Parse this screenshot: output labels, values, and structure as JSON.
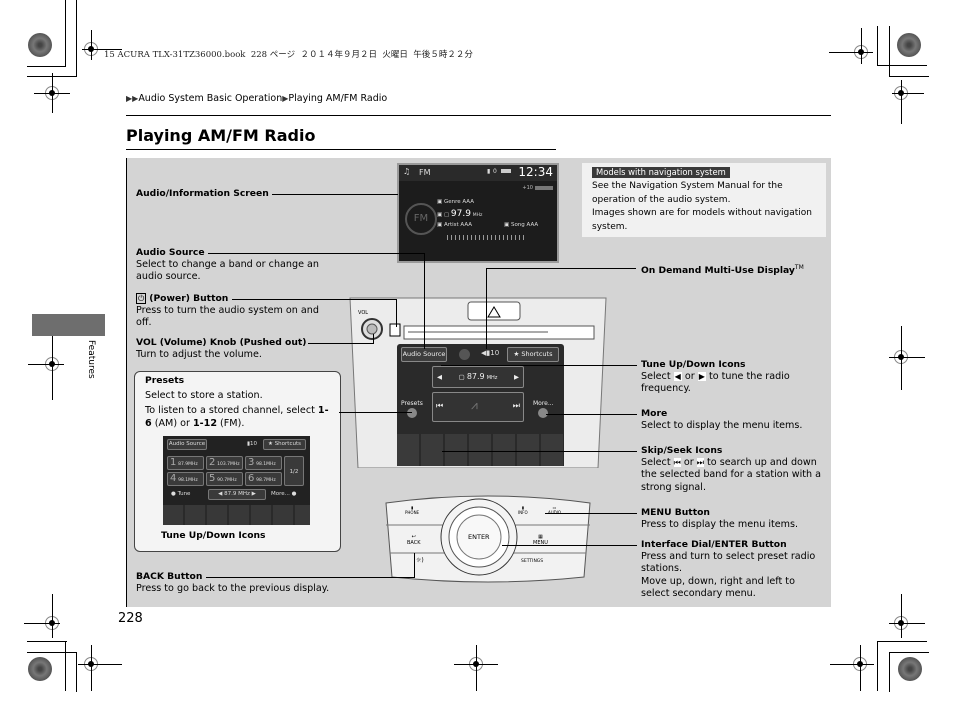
{
  "header_note": "15 ACURA TLX-31TZ36000.book  228 ページ  ２０１４年９月２日  火曜日  午後５時２２分",
  "breadcrumb": {
    "prefix": "▶▶",
    "section": "Audio System Basic Operation",
    "sep": "▶",
    "current": "Playing AM/FM Radio"
  },
  "page_title": "Playing AM/FM Radio",
  "side_tab_label": "Features",
  "page_number": "228",
  "nav_note": {
    "tag": "Models with navigation system",
    "line1": "See the Navigation System Manual for the operation of the audio system.",
    "line2": "Images shown are for models without navigation system."
  },
  "callouts_left": {
    "audio_info_screen": {
      "title": "Audio/Information Screen"
    },
    "audio_source": {
      "title": "Audio Source",
      "desc": "Select to change a band or change an audio source."
    },
    "power_button": {
      "icon": "⏻",
      "title": "(Power) Button",
      "desc": "Press to turn the audio system on and off."
    },
    "vol_knob": {
      "title": "VOL (Volume) Knob (Pushed out)",
      "desc": "Turn to adjust the volume."
    },
    "presets": {
      "title": "Presets",
      "desc1": "Select to store a station.",
      "desc2_a": "To listen to a stored channel, select ",
      "desc2_b": "1-6",
      "desc2_c": " (AM) or ",
      "desc2_d": "1-12",
      "desc2_e": " (FM).",
      "tune_label": "Tune Up/Down Icons"
    },
    "back_button": {
      "title": "BACK Button",
      "desc": "Press to go back to the previous display."
    }
  },
  "callouts_right": {
    "on_demand": {
      "title": "On Demand Multi-Use Display",
      "tm": "TM"
    },
    "tune_icons": {
      "title": "Tune Up/Down Icons",
      "desc_a": "Select ",
      "icon_left": "◀",
      "desc_b": " or ",
      "icon_right": "▶",
      "desc_c": " to tune the radio frequency."
    },
    "more": {
      "title": "More",
      "desc": "Select to display the menu items."
    },
    "skip_seek": {
      "title": "Skip/Seek Icons",
      "desc_a": "Select ",
      "icon_left": "⏮",
      "desc_b": " or ",
      "icon_right": "⏭",
      "desc_c": " to search up and down the selected band for a station with a strong signal."
    },
    "menu_button": {
      "title": "MENU Button",
      "desc": "Press to display the menu items."
    },
    "interface_dial": {
      "title": "Interface Dial/ENTER Button",
      "desc1": "Press and turn to select preset radio stations.",
      "desc2": "Move up, down, right and left to select secondary menu."
    }
  },
  "info_screen": {
    "band": "FM",
    "clock": "12:34",
    "status": "0",
    "volume": "10",
    "genre": "Genre AAA",
    "frequency": "97.9",
    "freq_unit": "MHz",
    "artist": "Artist AAA",
    "song": "Song AAA"
  },
  "touch_screen": {
    "audio_source": "Audio Source",
    "volume": "10",
    "shortcuts": "Shortcuts",
    "frequency": "87.9",
    "freq_unit": "MHz",
    "presets": "Presets",
    "more": "More..."
  },
  "mini_screen": {
    "audio_source": "Audio Source",
    "volume": "10",
    "shortcuts": "Shortcuts",
    "presets": [
      {
        "num": "1",
        "freq": "87.9MHz"
      },
      {
        "num": "2",
        "freq": "103.7MHz"
      },
      {
        "num": "3",
        "freq": "98.1MHz"
      },
      {
        "num": "4",
        "freq": "98.1MHz"
      },
      {
        "num": "5",
        "freq": "90.7MHz"
      },
      {
        "num": "6",
        "freq": "98.7MHz"
      }
    ],
    "page": "1/2",
    "tune": "Tune",
    "frequency": "87.9 MHz",
    "more": "More..."
  },
  "control_panel": {
    "enter": "ENTER",
    "phone": "PHONE",
    "info": "INFO",
    "audio": "AUDIO",
    "back": "BACK",
    "menu": "MENU",
    "settings": "SETTINGS"
  },
  "dash": {
    "vol": "VOL"
  }
}
